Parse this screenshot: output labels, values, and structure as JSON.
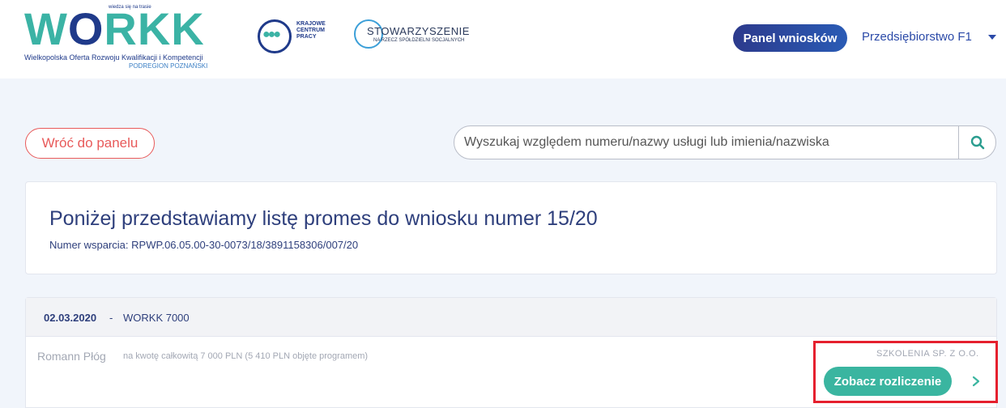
{
  "header": {
    "logo": {
      "wordmark_pre": "W",
      "wordmark_o": "O",
      "wordmark_post": "RKK",
      "tagline": "Wielkopolska Oferta Rozwoju Kwalifikacji i Kompetencji",
      "region": "PODREGION POZNAŃSKI",
      "arc_text": "wiedza się na trasie"
    },
    "partner_kcp": {
      "line1": "KRAJOWE",
      "line2": "CENTRUM",
      "line3": "PRACY"
    },
    "partner_stow": {
      "main": "STOWARZYSZENIE",
      "sub": "NA RZECZ SPÓŁDZIELNI SOCJALNYCH"
    },
    "panel_button": "Panel wniosków",
    "user_menu": "Przedsiębiorstwo F1"
  },
  "toolbar": {
    "back_button": "Wróć do panelu",
    "search_placeholder": "Wyszukaj względem numeru/nazwy usługi lub imienia/nazwiska"
  },
  "title_card": {
    "title": "Poniżej przedstawiamy listę promes do wniosku numer 15/20",
    "subtitle": "Numer wsparcia: RPWP.06.05.00-30-0073/18/3891158306/007/20"
  },
  "promise": {
    "date": "02.03.2020",
    "separator": "-",
    "name": "WORKK 7000",
    "person": "Romann Płóg",
    "amount_text": "na kwotę całkowitą 7 000 PLN (5 410 PLN objęte programem)",
    "company": "SZKOLENIA SP. Z O.O.",
    "action_button": "Zobacz rozliczenie"
  },
  "colors": {
    "primary_navy": "#2e3f7c",
    "teal": "#3ab5a0",
    "back_red": "#e85a5a",
    "highlight_red": "#e5202e"
  },
  "icons": {
    "search": "search-icon",
    "user_caret": "caret-down-icon",
    "row_chevron": "chevron-right-icon"
  }
}
